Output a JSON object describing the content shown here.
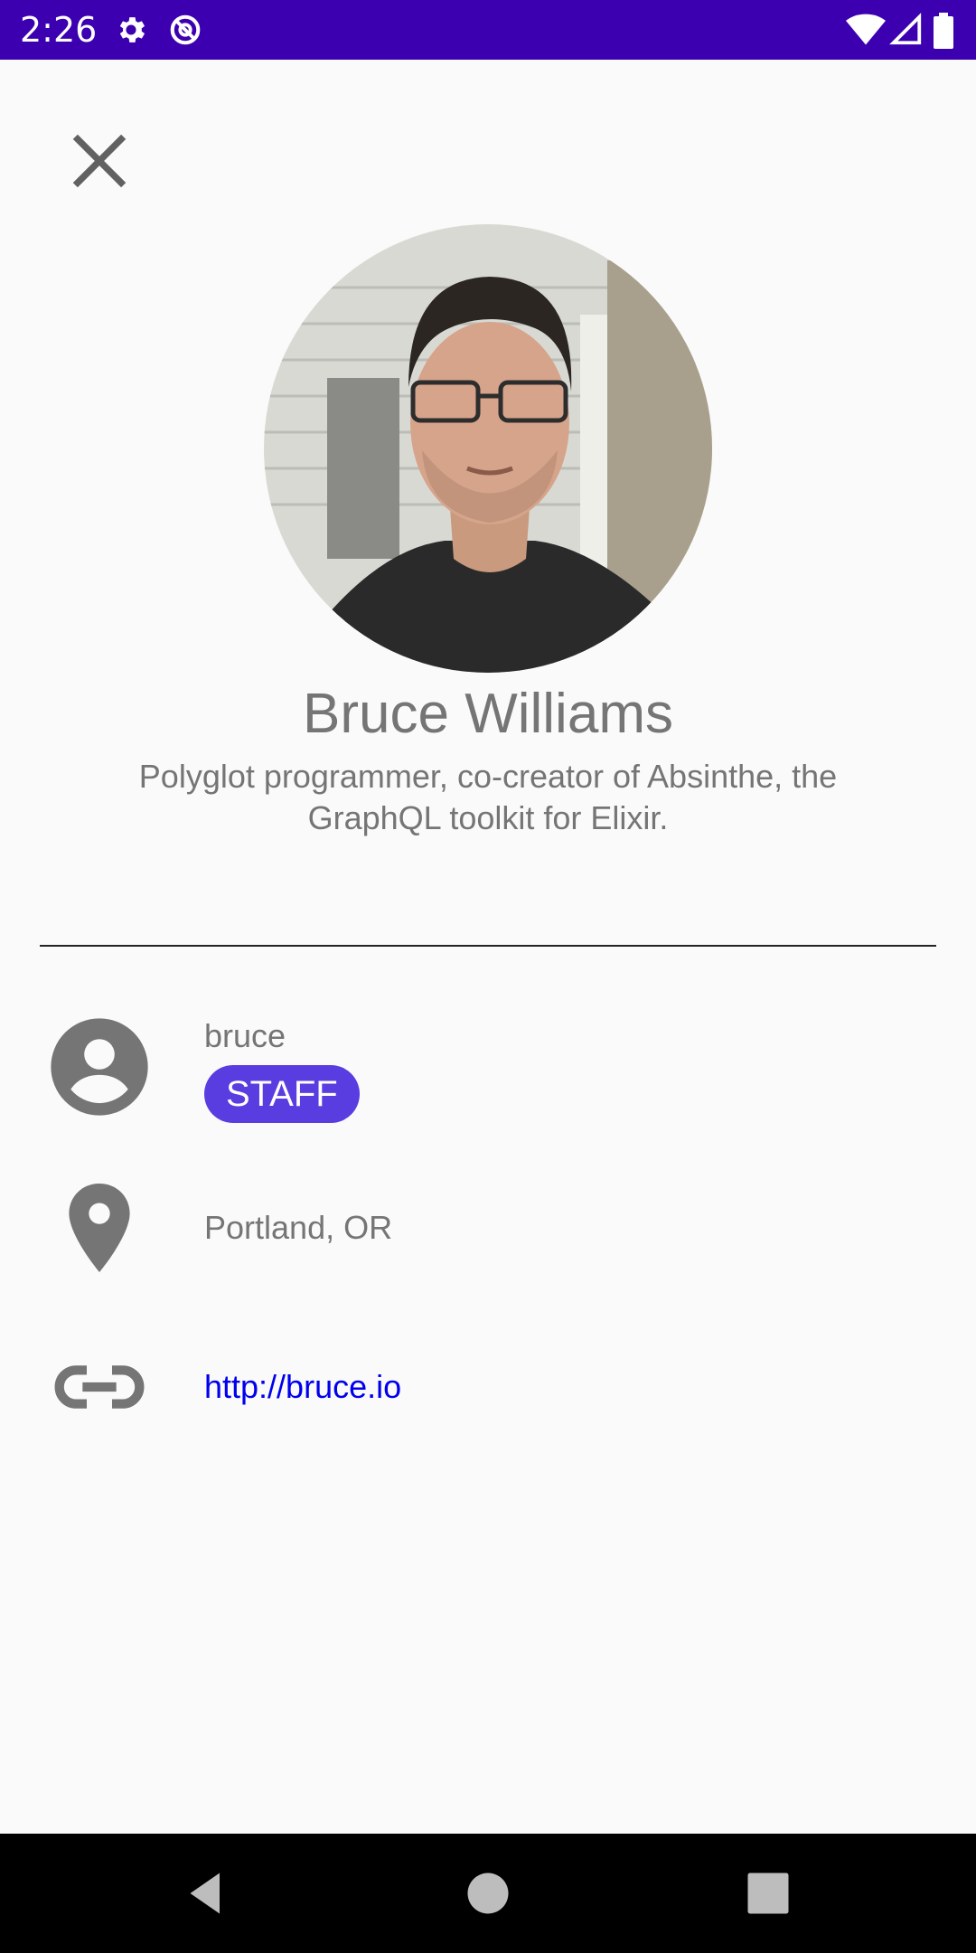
{
  "status_bar": {
    "time": "2:26",
    "icons": [
      "gear-icon",
      "no-disturb-icon",
      "wifi-icon",
      "signal-icon",
      "battery-icon"
    ]
  },
  "header": {
    "close_icon": "close-icon"
  },
  "profile": {
    "name": "Bruce Williams",
    "bio": "Polyglot programmer, co-creator of Absinthe, the GraphQL toolkit for Elixir."
  },
  "details": {
    "username": "bruce",
    "badge": "STAFF",
    "location": "Portland, OR",
    "website": "http://bruce.io"
  },
  "colors": {
    "status_bar": "#3d00b0",
    "badge": "#5a3de0",
    "link": "#0000ee",
    "icon": "#757575"
  },
  "nav_bar": {
    "icons": [
      "back-icon",
      "home-icon",
      "recents-icon"
    ]
  }
}
